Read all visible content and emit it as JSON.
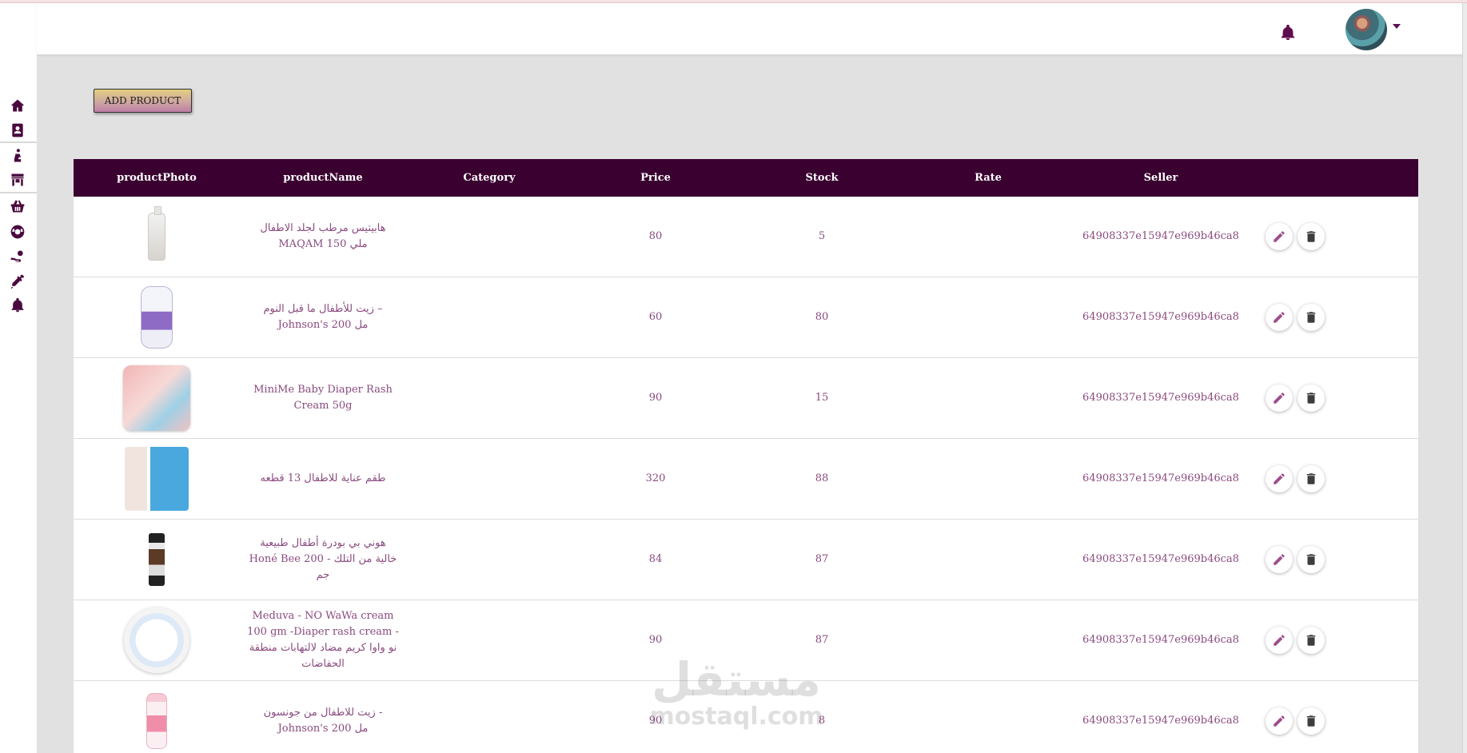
{
  "header": {
    "icons": {
      "bell": "bell-icon",
      "avatar": "user-avatar",
      "caret": "chevron-down-icon"
    }
  },
  "sidebar": {
    "items": [
      {
        "icon": "home-icon"
      },
      {
        "icon": "address-book-icon"
      },
      {
        "icon": "person-carry-icon"
      },
      {
        "icon": "store-icon"
      },
      {
        "icon": "basket-icon"
      },
      {
        "icon": "life-ring-icon"
      },
      {
        "icon": "hand-coins-icon"
      },
      {
        "icon": "syringe-icon"
      },
      {
        "icon": "bell-icon"
      }
    ]
  },
  "toolbar": {
    "add_label": "ADD PRODUCT"
  },
  "table": {
    "columns": {
      "photo": "productPhoto",
      "name": "productName",
      "category": "Category",
      "price": "Price",
      "stock": "Stock",
      "rate": "Rate",
      "seller": "Seller"
    },
    "rows": [
      {
        "name": "هابيتيس مرطب لجلد الاطفال MAQAM 150 ملي",
        "category": "",
        "price": "80",
        "stock": "5",
        "rate": "",
        "seller": "64908337e15947e969b46ca8"
      },
      {
        "name": "زيت للأطفال ما قبل النوم – Johnson's 200 مل",
        "category": "",
        "price": "60",
        "stock": "80",
        "rate": "",
        "seller": "64908337e15947e969b46ca8"
      },
      {
        "name": "MiniMe Baby Diaper Rash Cream 50g",
        "category": "",
        "price": "90",
        "stock": "15",
        "rate": "",
        "seller": "64908337e15947e969b46ca8"
      },
      {
        "name": "طقم عناية للاطفال 13 قطعه",
        "category": "",
        "price": "320",
        "stock": "88",
        "rate": "",
        "seller": "64908337e15947e969b46ca8"
      },
      {
        "name": "هوني بي بودرة أطفال طبيعية Honé Bee خالية من التلك - 200 جم",
        "category": "",
        "price": "84",
        "stock": "87",
        "rate": "",
        "seller": "64908337e15947e969b46ca8"
      },
      {
        "name": "Meduva - NO WaWa cream 100 gm -Diaper rash cream - نو واوا كريم مضاد لالتهابات منطقة الحفاضات",
        "category": "",
        "price": "90",
        "stock": "87",
        "rate": "",
        "seller": "64908337e15947e969b46ca8"
      },
      {
        "name": "زيت للاطفال من جونسون - Johnson's 200 مل",
        "category": "",
        "price": "90",
        "stock": "8",
        "rate": "",
        "seller": "64908337e15947e969b46ca8"
      }
    ]
  },
  "watermark": {
    "arabic": "مستقل",
    "latin": "mostaql.com"
  },
  "colors": {
    "header_bg": "#3a0030",
    "accent": "#5e0d4f",
    "text": "#8a4a7e"
  }
}
